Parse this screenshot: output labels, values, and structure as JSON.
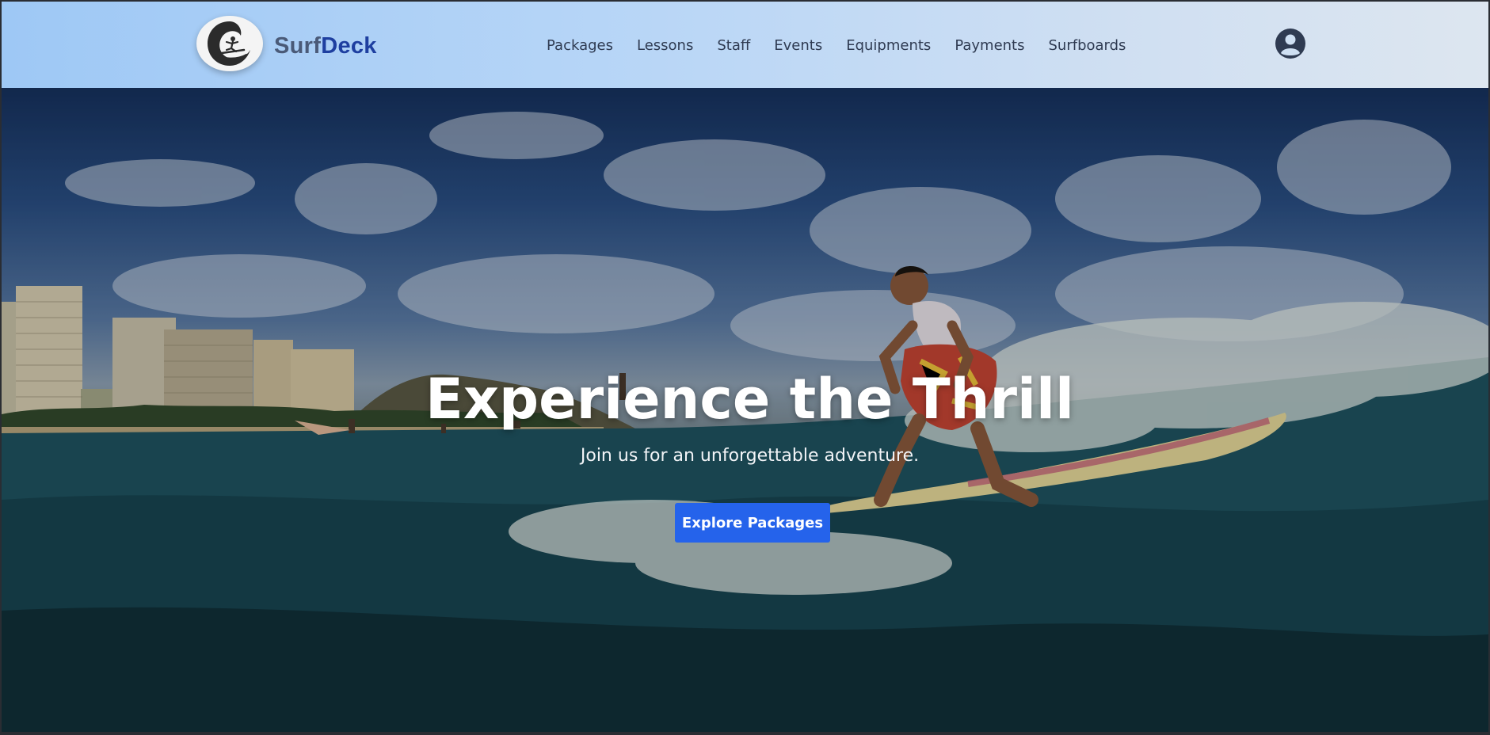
{
  "brand": {
    "name_part1": "Surf",
    "name_part2": "Deck"
  },
  "nav": {
    "items": [
      {
        "label": "Packages"
      },
      {
        "label": "Lessons"
      },
      {
        "label": "Staff"
      },
      {
        "label": "Events"
      },
      {
        "label": "Equipments"
      },
      {
        "label": "Payments"
      },
      {
        "label": "Surfboards"
      }
    ]
  },
  "header": {
    "user_icon": "user-circle-icon",
    "logo_icon": "surfer-wave-logo-icon"
  },
  "hero": {
    "title": "Experience the Thrill",
    "subtitle": "Join us for an unforgettable adventure.",
    "cta_label": "Explore Packages",
    "background": "surfer-riding-wave-photo"
  },
  "colors": {
    "header_start": "#9ec8f5",
    "header_end": "#dde6f0",
    "brand_deck": "#1e3fa0",
    "cta": "#2563eb"
  }
}
